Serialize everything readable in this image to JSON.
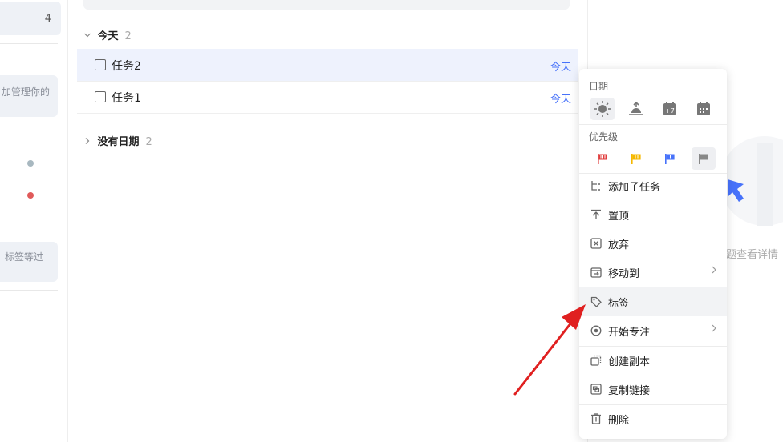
{
  "sidebar": {
    "count": "4",
    "card1_text": "加管理你的",
    "card2_text": "标签等过",
    "dot_colors": [
      "#a8b8c0",
      "#e05a5a"
    ]
  },
  "groups": {
    "today": {
      "label": "今天",
      "count": "2"
    },
    "nodate": {
      "label": "没有日期",
      "count": "2"
    }
  },
  "tasks": [
    {
      "title": "任务2",
      "date": "今天"
    },
    {
      "title": "任务1",
      "date": "今天"
    }
  ],
  "detail": {
    "hint": "题查看详情"
  },
  "menu": {
    "date_label": "日期",
    "date_icons": [
      "sun-icon",
      "sunrise-icon",
      "calendar-plus7-icon",
      "calendar-icon"
    ],
    "date_icon_badge": "+7",
    "priority_label": "优先级",
    "priority_colors": [
      "#e03e3e",
      "#f5b800",
      "#4772fa",
      "#888888"
    ],
    "items": [
      {
        "label": "添加子任务",
        "icon": "subtask-icon"
      },
      {
        "label": "置顶",
        "icon": "pin-top-icon"
      },
      {
        "label": "放弃",
        "icon": "abandon-icon"
      },
      {
        "label": "移动到",
        "icon": "move-to-icon",
        "submenu": true
      },
      {
        "label": "标签",
        "icon": "tag-icon",
        "highlighted": true
      },
      {
        "label": "开始专注",
        "icon": "focus-icon",
        "submenu": true
      },
      {
        "label": "创建副本",
        "icon": "duplicate-icon"
      },
      {
        "label": "复制链接",
        "icon": "copy-link-icon"
      },
      {
        "label": "删除",
        "icon": "trash-icon"
      }
    ]
  },
  "annotation": {
    "arrow_color": "#e02020"
  }
}
